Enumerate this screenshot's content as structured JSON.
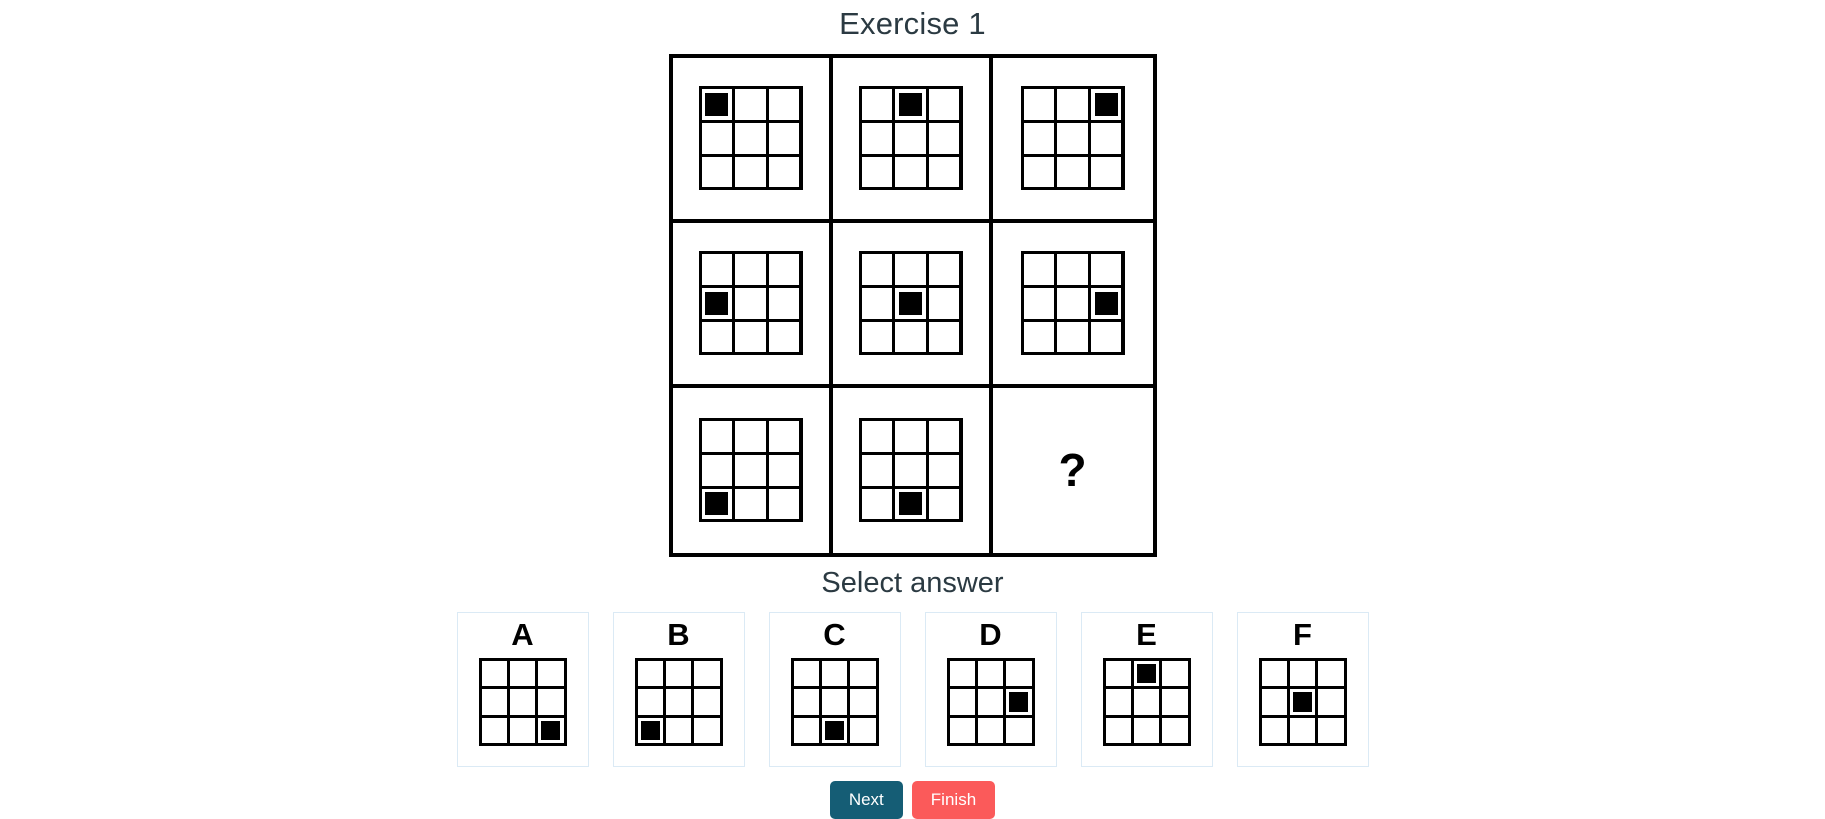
{
  "header": {
    "title": "Exercise 1"
  },
  "matrix": {
    "rows": 3,
    "cols": 3,
    "cells": [
      {
        "id": "matrix-cell-r0c0",
        "type": "figure",
        "filled_index": 0,
        "label": ""
      },
      {
        "id": "matrix-cell-r0c1",
        "type": "figure",
        "filled_index": 1,
        "label": ""
      },
      {
        "id": "matrix-cell-r0c2",
        "type": "figure",
        "filled_index": 2,
        "label": ""
      },
      {
        "id": "matrix-cell-r1c0",
        "type": "figure",
        "filled_index": 3,
        "label": ""
      },
      {
        "id": "matrix-cell-r1c1",
        "type": "figure",
        "filled_index": 4,
        "label": ""
      },
      {
        "id": "matrix-cell-r1c2",
        "type": "figure",
        "filled_index": 5,
        "label": ""
      },
      {
        "id": "matrix-cell-r2c0",
        "type": "figure",
        "filled_index": 6,
        "label": ""
      },
      {
        "id": "matrix-cell-r2c1",
        "type": "figure",
        "filled_index": 7,
        "label": ""
      },
      {
        "id": "matrix-cell-r2c2",
        "type": "question",
        "filled_index": -1,
        "label": "?"
      }
    ]
  },
  "select_answer_label": "Select answer",
  "options": [
    {
      "letter": "A",
      "filled_index": 8
    },
    {
      "letter": "B",
      "filled_index": 6
    },
    {
      "letter": "C",
      "filled_index": 7
    },
    {
      "letter": "D",
      "filled_index": 5
    },
    {
      "letter": "E",
      "filled_index": 1
    },
    {
      "letter": "F",
      "filled_index": 4
    }
  ],
  "buttons": {
    "next_label": "Next",
    "finish_label": "Finish"
  },
  "colors": {
    "title_text": "#2b3a42",
    "grid_line": "#000000",
    "square_fill": "#000000",
    "option_border": "#dbeaf5",
    "next_bg": "#155d75",
    "finish_bg": "#fb5a5a",
    "page_bg": "#ffffff"
  }
}
